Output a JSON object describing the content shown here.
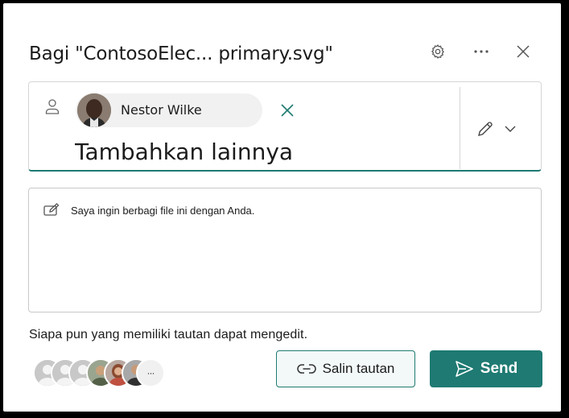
{
  "dialog": {
    "title": "Bagi \"ContosoElec... primary.svg\"",
    "header_icons": [
      "gear-icon",
      "more-icon",
      "close-icon"
    ]
  },
  "recipients": {
    "chip_name": "Nestor Wilke",
    "add_more_placeholder": "Tambahkan lainnya",
    "permission_icon": "pencil-icon"
  },
  "message": {
    "text": "Saya ingin berbagi file ini dengan Anda."
  },
  "link": {
    "description": "Siapa pun yang memiliki tautan dapat mengedit.",
    "more_label": "···"
  },
  "actions": {
    "copy_label": "Salin tautan",
    "send_label": "Send"
  },
  "colors": {
    "accent": "#1e7a72",
    "copy_bg": "#f3f9f9"
  }
}
